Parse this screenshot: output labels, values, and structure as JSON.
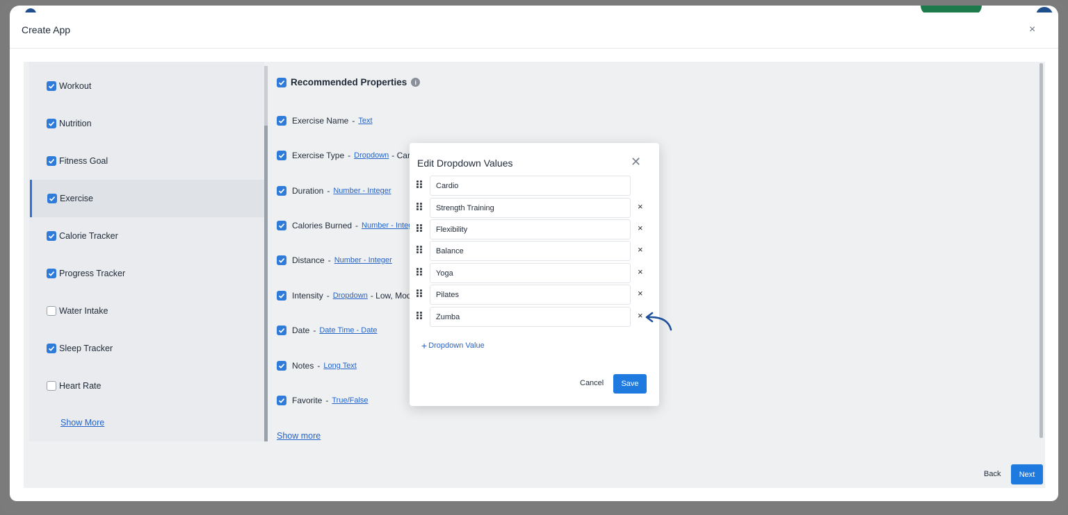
{
  "modal": {
    "title": "Create App",
    "close_icon": "×"
  },
  "sidebar": {
    "items": [
      {
        "label": "Workout",
        "checked": true
      },
      {
        "label": "Nutrition",
        "checked": true
      },
      {
        "label": "Fitness Goal",
        "checked": true
      },
      {
        "label": "Exercise",
        "checked": true,
        "active": true
      },
      {
        "label": "Calorie Tracker",
        "checked": true
      },
      {
        "label": "Progress Tracker",
        "checked": true
      },
      {
        "label": "Water Intake",
        "checked": false
      },
      {
        "label": "Sleep Tracker",
        "checked": true
      },
      {
        "label": "Heart Rate",
        "checked": false
      }
    ],
    "show_more": "Show More"
  },
  "properties": {
    "heading": "Recommended Properties",
    "items": [
      {
        "name": "Exercise Name",
        "type": "Text",
        "extra": ""
      },
      {
        "name": "Exercise Type",
        "type": "Dropdown",
        "extra": "- Card"
      },
      {
        "name": "Duration",
        "type": "Number - Integer",
        "extra": ""
      },
      {
        "name": "Calories Burned",
        "type": "Number - Integ",
        "extra": ""
      },
      {
        "name": "Distance",
        "type": "Number - Integer",
        "extra": ""
      },
      {
        "name": "Intensity",
        "type": "Dropdown",
        "extra": "- Low, Mod"
      },
      {
        "name": "Date",
        "type": "Date Time - Date",
        "extra": ""
      },
      {
        "name": "Notes",
        "type": "Long Text",
        "extra": ""
      },
      {
        "name": "Favorite",
        "type": "True/False",
        "extra": ""
      }
    ],
    "separator": "-",
    "show_more": "Show more"
  },
  "footer": {
    "back": "Back",
    "next": "Next"
  },
  "dialog": {
    "title": "Edit Dropdown Values",
    "close_icon": "✕",
    "values": [
      "Cardio",
      "Strength Training",
      "Flexibility",
      "Balance",
      "Yoga",
      "Pilates",
      "Zumba"
    ],
    "remove_icon": "×",
    "add_label": "Dropdown Value",
    "add_icon": "+",
    "cancel": "Cancel",
    "save": "Save"
  },
  "colors": {
    "accent": "#1f7ae0",
    "link": "#2563c9",
    "annotation_arrow": "#1e4f9a"
  }
}
